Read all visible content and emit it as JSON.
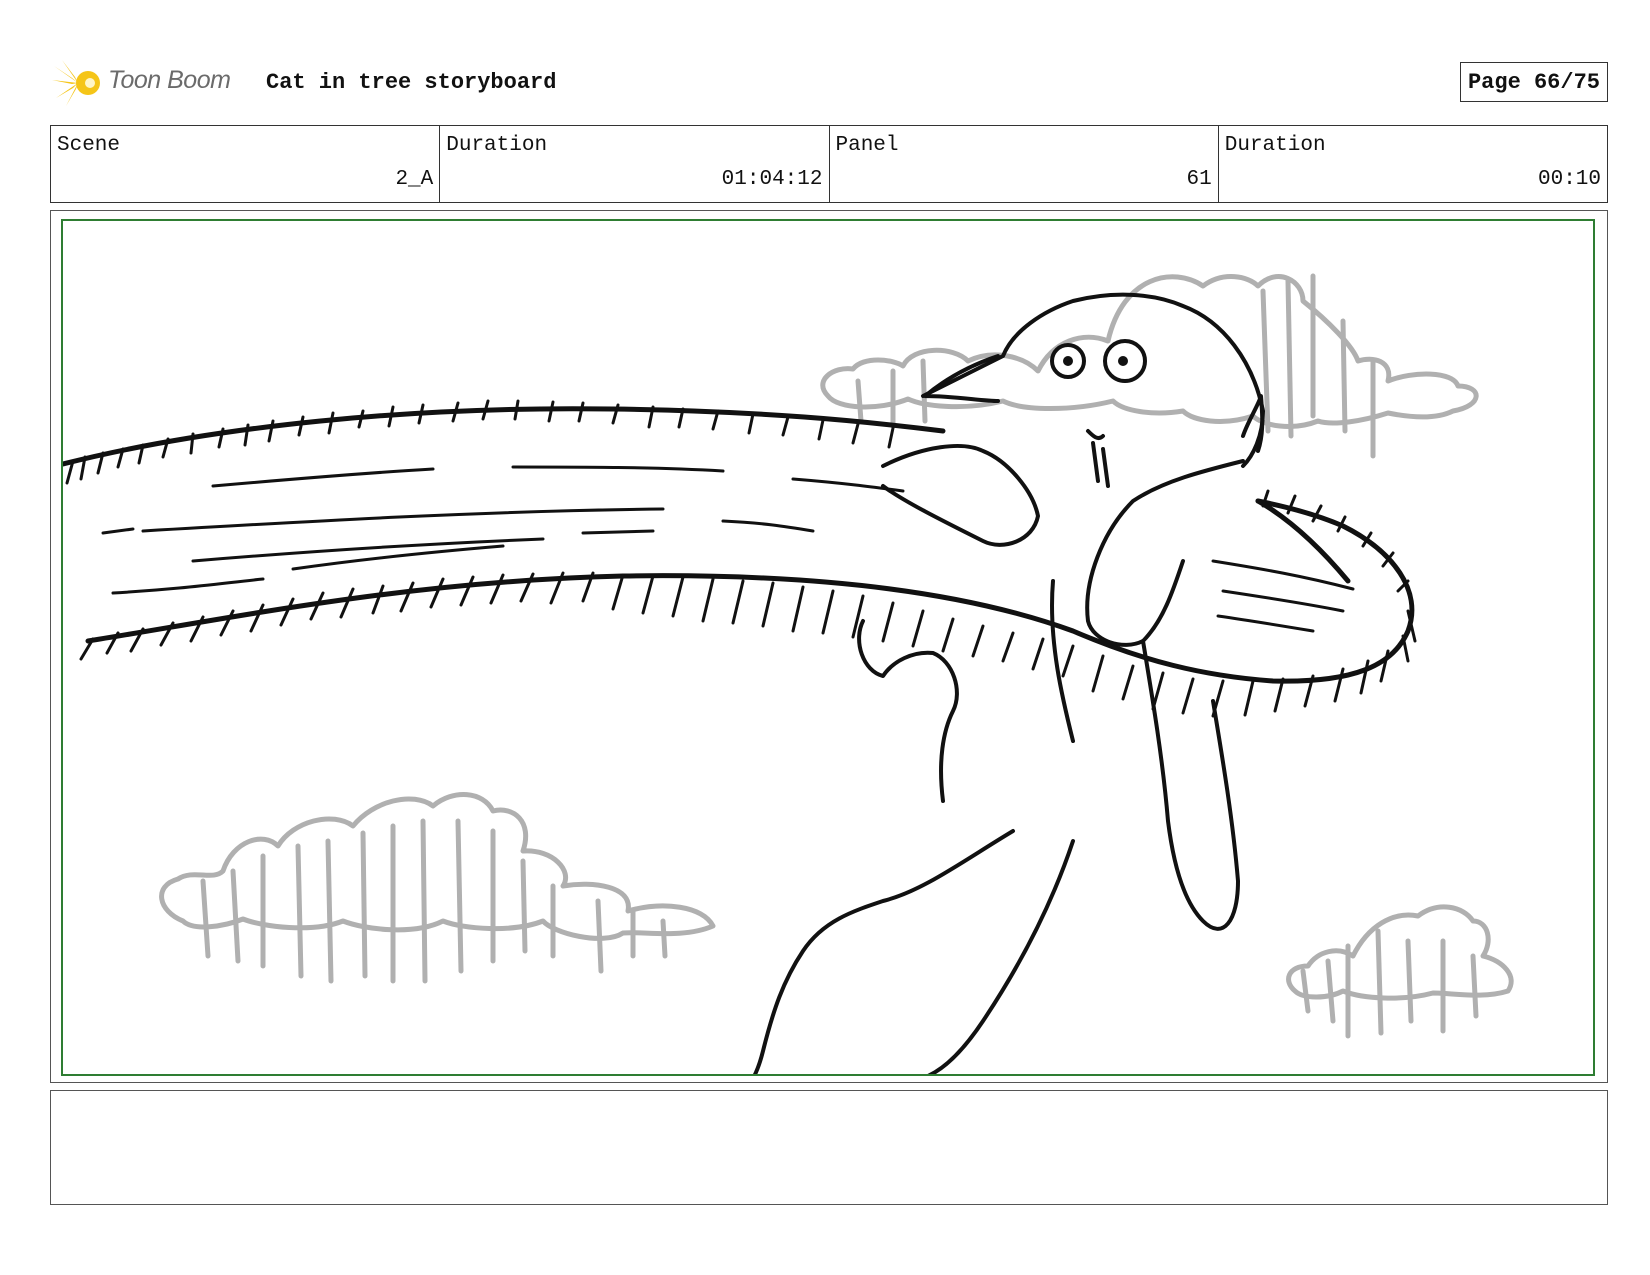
{
  "header": {
    "logo_text": "Toon Boom",
    "title": "Cat in tree storyboard",
    "page": "Page 66/75"
  },
  "info": {
    "scene_label": "Scene",
    "scene_value": "2_A",
    "duration_label": "Duration",
    "duration_value": "01:04:12",
    "panel_label": "Panel",
    "panel_value": "61",
    "panel_duration_label": "Duration",
    "panel_duration_value": "00:10"
  },
  "notes": {
    "text": ""
  },
  "colors": {
    "safe_frame": "#2e7d32",
    "logo_yellow": "#f5c518",
    "sketch_black": "#111111",
    "cloud_grey": "#b0b0b0"
  },
  "icons": {
    "logo": "toon-boom-star-icon"
  }
}
